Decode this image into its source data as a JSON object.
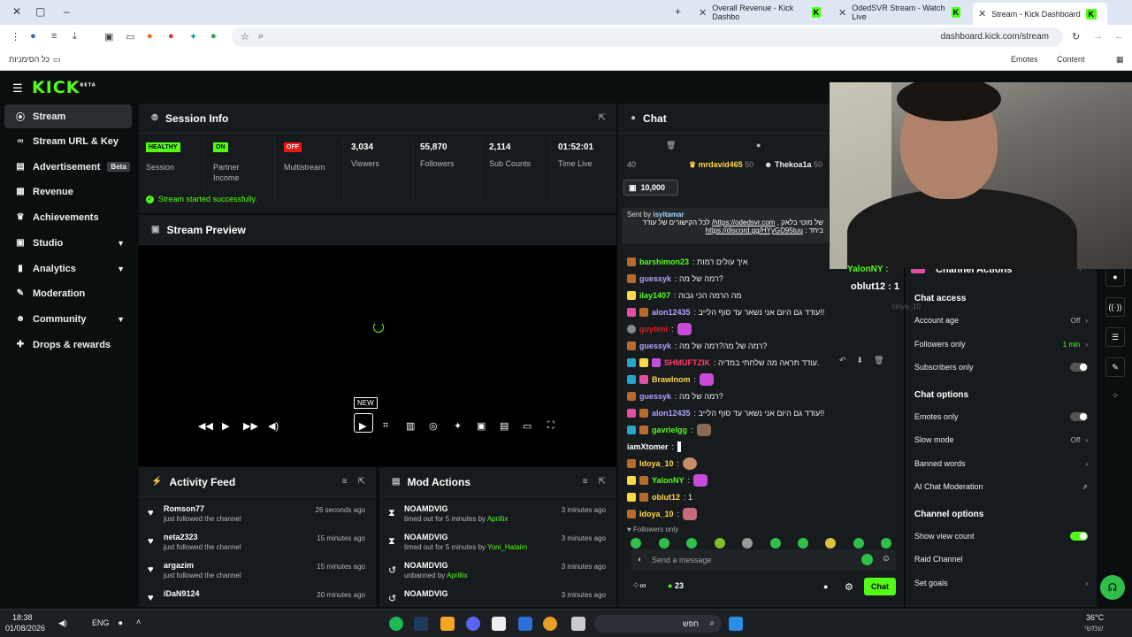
{
  "browser": {
    "tabs": [
      {
        "title": "Overall Revenue - Kick Dashbo"
      },
      {
        "title": "OdedSVR Stream - Watch Live"
      },
      {
        "title": "Stream - Kick Dashboard"
      }
    ],
    "url": "dashboard.kick.com/stream",
    "bookmarks_all": "כל הסימניות",
    "bookmark_emotes": "Emotes",
    "bookmark_content": "Content"
  },
  "header": {
    "logo": "KICK",
    "logo_beta": "BETA"
  },
  "sidebar": {
    "items": [
      {
        "label": "Stream",
        "icon": "stream-icon"
      },
      {
        "label": "Stream URL & Key",
        "icon": "link-icon"
      },
      {
        "label": "Advertisement",
        "icon": "ad-icon",
        "badge": "Beta"
      },
      {
        "label": "Revenue",
        "icon": "revenue-icon"
      },
      {
        "label": "Achievements",
        "icon": "trophy-icon"
      },
      {
        "label": "Studio",
        "icon": "studio-icon"
      },
      {
        "label": "Analytics",
        "icon": "chart-icon"
      },
      {
        "label": "Moderation",
        "icon": "wrench-icon"
      },
      {
        "label": "Community",
        "icon": "people-icon"
      },
      {
        "label": "Drops & rewards",
        "icon": "gift-icon"
      }
    ]
  },
  "session": {
    "title": "Session Info",
    "stats": [
      {
        "badge": "HEALTHY",
        "label": "Session"
      },
      {
        "badge": "ON",
        "label": "Partner Income"
      },
      {
        "badge": "OFF",
        "label": "Multistream"
      },
      {
        "value": "3,034",
        "label": "Viewers"
      },
      {
        "value": "55,870",
        "label": "Followers"
      },
      {
        "value": "2,114",
        "label": "Sub Counts"
      },
      {
        "value": "01:52:01",
        "label": "Time Live"
      }
    ],
    "success": "Stream started successfully."
  },
  "preview": {
    "title": "Stream Preview",
    "new_badge": "NEW"
  },
  "activity": {
    "title": "Activity Feed",
    "rows": [
      {
        "user": "Romson77",
        "action": "just followed the channel",
        "time": "26 seconds ago"
      },
      {
        "user": "neta2323",
        "action": "just followed the channel",
        "time": "15 minutes ago"
      },
      {
        "user": "argazim",
        "action": "just followed the channel",
        "time": "15 minutes ago"
      },
      {
        "user": "iDaN9124",
        "action": "",
        "time": "20 minutes ago"
      }
    ]
  },
  "mod": {
    "title": "Mod Actions",
    "rows": [
      {
        "user": "NOAMDVIG",
        "action": "timed out for 5 minutes by",
        "target": "Aprillix",
        "time": "3 minutes ago"
      },
      {
        "user": "NOAMDVIG",
        "action": "timed out for 5 minutes by",
        "target": "Yoni_Hataim",
        "time": "3 minutes ago"
      },
      {
        "user": "NOAMDVIG",
        "action": "unbanned by",
        "target": "Aprillix",
        "time": "3 minutes ago"
      },
      {
        "user": "NOAMDVIG",
        "action": "",
        "target": "",
        "time": "3 minutes ago"
      }
    ]
  },
  "chat": {
    "title": "Chat",
    "top_count": "40",
    "top_users": [
      {
        "name": "mrdavid465",
        "n": "50"
      },
      {
        "name": "Thekoa1a",
        "n": "50"
      }
    ],
    "goal": "10,000",
    "pinned_sent_by": "Sent by",
    "pinned_user": "isyitamar",
    "pinned_text1": "של מוטי בלאק ,",
    "pinned_link1": "https://odedsvr.com/",
    "pinned_text2": "לכל הקישורים של עודד",
    "pinned_text3": "ביחד :",
    "pinned_link2": "https://discord.gg/HYyGD95tuu",
    "messages": [
      {
        "user": "barshimon23",
        "color": "#53fc18",
        "text": ": איך עולים רמות"
      },
      {
        "user": "guessyk",
        "color": "#a8a8ff",
        "text": ": רמה של מה?"
      },
      {
        "user": "ilay1407",
        "color": "#53fc18",
        "text": ": מה הרמה הכי גבוה"
      },
      {
        "user": "alon12435",
        "color": "#a8a8ff",
        "text": ": עודד גם היום אני נשאר עד סוף הלייב!!"
      },
      {
        "user": "guyteni",
        "color": "#e91916",
        "text": ":"
      },
      {
        "user": "guessyk",
        "color": "#a8a8ff",
        "text": ": רמה של מה?רמה של מה?"
      },
      {
        "user": "SHMUFTZIK",
        "color": "#ff3b6b",
        "text": ": עודד תראה מה שלחתי במדיה."
      },
      {
        "user": "Brawlnom",
        "color": "#ffd84a",
        "text": ":"
      },
      {
        "user": "guessyk",
        "color": "#a8a8ff",
        "text": ": רמה של מה?"
      },
      {
        "user": "alon12435",
        "color": "#a8a8ff",
        "text": ": עודד גם היום אני נשאר עד סוף הלייב!!"
      },
      {
        "user": "gavrielgg",
        "color": "#53fc18",
        "text": ":"
      },
      {
        "user": "iamXtomer",
        "color": "#ffffff",
        "text": ":"
      },
      {
        "user": "Idoya_10",
        "color": "#ffd84a",
        "text": ":"
      },
      {
        "user": "YalonNY",
        "color": "#53fc18",
        "text": ":"
      },
      {
        "user": "oblut12",
        "color": "#ffd84a",
        "text": ": 1"
      },
      {
        "user": "Idoya_10",
        "color": "#ffd84a",
        "text": ":"
      }
    ],
    "followers_only": "Followers only",
    "input_placeholder": "Send a message",
    "count": "23",
    "send": "Chat"
  },
  "overlay": {
    "user1": "YalonNY :",
    "user2": "oblut12 : 1",
    "user3": "Idoya_10"
  },
  "channel_actions": {
    "title": "Channel Actions",
    "chat_access": "Chat access",
    "account_age": "Account age",
    "account_age_value": "Off",
    "followers_only": "Followers only",
    "followers_only_value": "1 min",
    "subscribers_only": "Subscribers only",
    "chat_options": "Chat options",
    "emotes_only": "Emotes only",
    "slow_mode": "Slow mode",
    "slow_mode_value": "Off",
    "banned_words": "Banned words",
    "ai_mod": "AI Chat Moderation",
    "channel_options": "Channel options",
    "show_view_count": "Show view count",
    "raid_channel": "Raid Channel",
    "set_goals": "Set goals"
  },
  "taskbar": {
    "time": "18:38",
    "date": "01/08/2026",
    "lang": "ENG",
    "search": "חפש",
    "temp": "36°C",
    "weather": "שמשי"
  }
}
